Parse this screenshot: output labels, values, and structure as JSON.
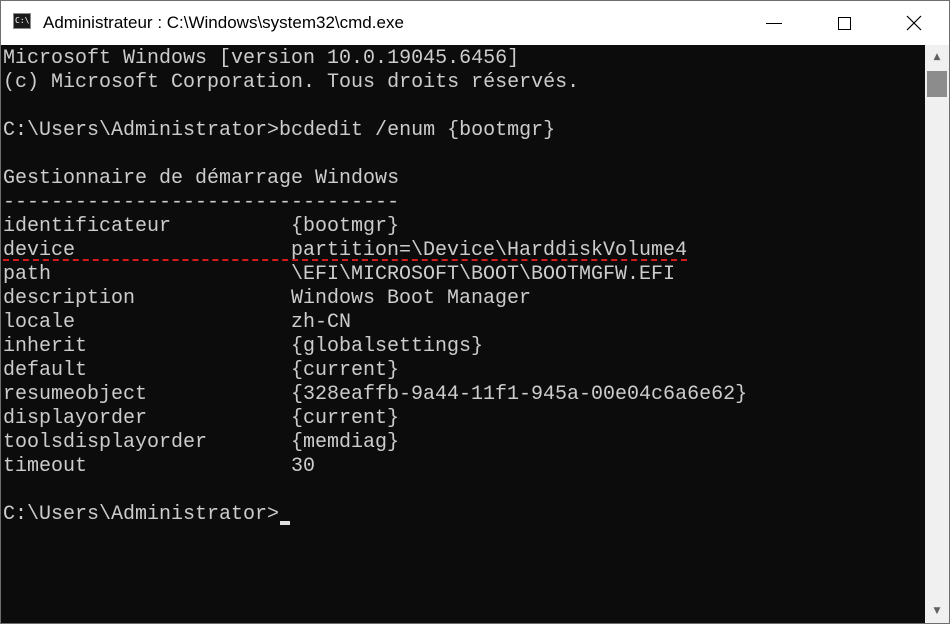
{
  "window": {
    "title": "Administrateur : C:\\Windows\\system32\\cmd.exe",
    "icon": "cmd-icon",
    "icon_text": "C:\\."
  },
  "console": {
    "header_line1": "Microsoft Windows [version 10.0.19045.6456]",
    "header_line2": "(c) Microsoft Corporation. Tous droits réservés.",
    "command_line": "C:\\Users\\Administrator>bcdedit /enum {bootmgr}",
    "section_title": "Gestionnaire de démarrage Windows",
    "section_rule": "---------------------------------",
    "entries": [
      {
        "key": "identificateur",
        "value": "{bootmgr}"
      },
      {
        "key": "device",
        "value": "partition=\\Device\\HarddiskVolume4"
      },
      {
        "key": "path",
        "value": "\\EFI\\MICROSOFT\\BOOT\\BOOTMGFW.EFI"
      },
      {
        "key": "description",
        "value": "Windows Boot Manager"
      },
      {
        "key": "locale",
        "value": "zh-CN"
      },
      {
        "key": "inherit",
        "value": "{globalsettings}"
      },
      {
        "key": "default",
        "value": "{current}"
      },
      {
        "key": "resumeobject",
        "value": "{328eaffb-9a44-11f1-945a-00e04c6a6e62}"
      },
      {
        "key": "displayorder",
        "value": "{current}"
      },
      {
        "key": "toolsdisplayorder",
        "value": "{memdiag}"
      },
      {
        "key": "timeout",
        "value": "30"
      }
    ],
    "prompt": "C:\\Users\\Administrator>"
  },
  "colors": {
    "console_bg": "#0c0c0c",
    "console_text": "#cccccc",
    "highlight_underline": "#d41a1a"
  }
}
